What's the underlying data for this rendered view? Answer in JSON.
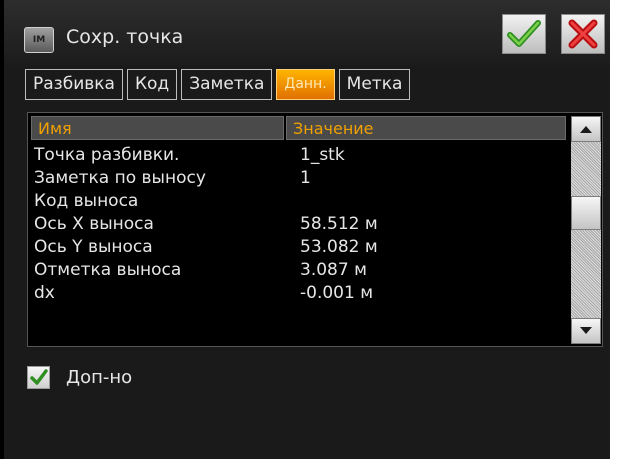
{
  "window": {
    "title": "Сохр. точка",
    "icon_name": "app-icon",
    "ok_icon": "check-icon",
    "close_icon": "close-icon"
  },
  "tabs": [
    {
      "label": "Разбивка",
      "active": false
    },
    {
      "label": "Код",
      "active": false
    },
    {
      "label": "Заметка",
      "active": false
    },
    {
      "label": "Данн.",
      "active": true
    },
    {
      "label": "Метка",
      "active": false
    }
  ],
  "table": {
    "headers": [
      "Имя",
      "Значение"
    ],
    "rows": [
      {
        "name": "Точка разбивки.",
        "value": "1_stk"
      },
      {
        "name": "Заметка по выносу",
        "value": "1"
      },
      {
        "name": "Код выноса",
        "value": ""
      },
      {
        "name": "Ось X выноса",
        "value": "58.512 м"
      },
      {
        "name": "Ось Y выноса",
        "value": "53.082 м"
      },
      {
        "name": "Отметка выноса",
        "value": "3.087 м"
      },
      {
        "name": "dx",
        "value": "-0.001 м"
      }
    ]
  },
  "option": {
    "label": "Доп-но",
    "checked": true
  },
  "colors": {
    "accent": "#f0a000",
    "active_tab": "#ff9a00",
    "background": "#1a1a1a"
  }
}
